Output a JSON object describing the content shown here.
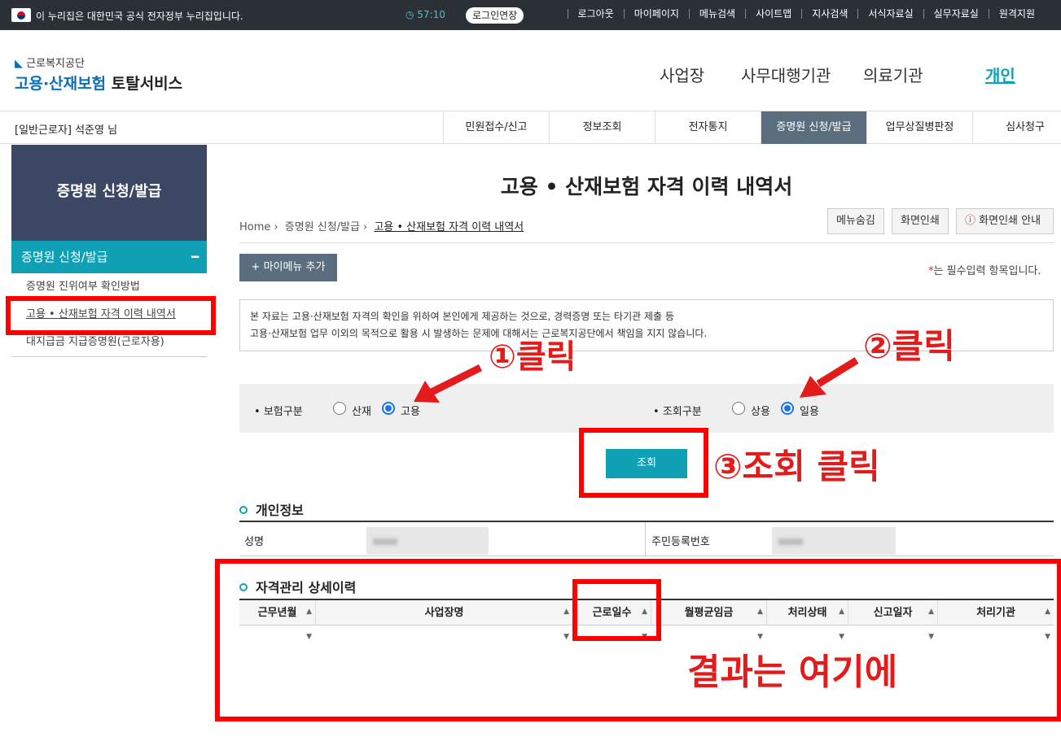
{
  "topbar": {
    "gov_notice": "이 누리집은 대한민국 공식 전자정부 누리집입니다.",
    "timer": "57:10",
    "extend_label": "로그인연장",
    "links": [
      "로그아웃",
      "마이페이지",
      "메뉴검색",
      "사이트맵",
      "지사검색",
      "서식자료실",
      "실무자료실",
      "원격지원"
    ]
  },
  "logo": {
    "agency": "근로복지공단",
    "service_blue": "고용·산재보험",
    "service_dark": "토탈서비스"
  },
  "gnb": [
    "사업장",
    "사무대행기관",
    "의료기관",
    "개인"
  ],
  "user": "[일반근로자] 석준영 님",
  "menu_tabs": [
    "민원접수/신고",
    "정보조회",
    "전자통지",
    "증명원 신청/발급",
    "업무상질병판정",
    "심사청구"
  ],
  "lnb": {
    "header": "증명원 신청/발급",
    "section": "증명원 신청/발급",
    "items": [
      "증명원 진위여부 확인방법",
      "고용 • 산재보험 자격 이력 내역서",
      "대지급금 지급증명원(근로자용)"
    ]
  },
  "page": {
    "title": "고용 • 산재보험 자격 이력 내역서",
    "breadcrumb": [
      "Home",
      "증명원 신청/발급",
      "고용 • 산재보험 자격 이력 내역서"
    ],
    "btn_hide_menu": "메뉴숨김",
    "btn_print": "화면인쇄",
    "btn_print_guide": "화면인쇄 안내",
    "mymenu": "마이메뉴 추가",
    "required_note": "는 필수입력 항목입니다.",
    "notice_line1": "본 자료는 고용·산재보험 자격의 확인을 위하여 본인에게 제공하는 것으로, 경력증명 또는 타기관 제출 등",
    "notice_line2": "고용·산재보험 업무 이외의 목적으로 활용 시 발생하는 문제에 대해서는 근로복지공단에서 책임을 지지 않습니다."
  },
  "filter": {
    "insurance_label": "보험구분",
    "insurance_options": [
      "산재",
      "고용"
    ],
    "insurance_selected": "고용",
    "query_label": "조회구분",
    "query_options": [
      "상용",
      "일용"
    ],
    "query_selected": "일용"
  },
  "search_label": "조회",
  "personal": {
    "heading": "개인정보",
    "name_label": "성명",
    "rrn_label": "주민등록번호"
  },
  "detail": {
    "heading": "자격관리 상세이력",
    "columns": [
      "근무년월",
      "사업장명",
      "근로일수",
      "월평균임금",
      "처리상태",
      "신고일자",
      "처리기관"
    ]
  },
  "annotations": {
    "step1": "①클릭",
    "step2": "②클릭",
    "step3": "③조회 클릭",
    "result": "결과는 여기에",
    "color": "#e31b1b"
  }
}
